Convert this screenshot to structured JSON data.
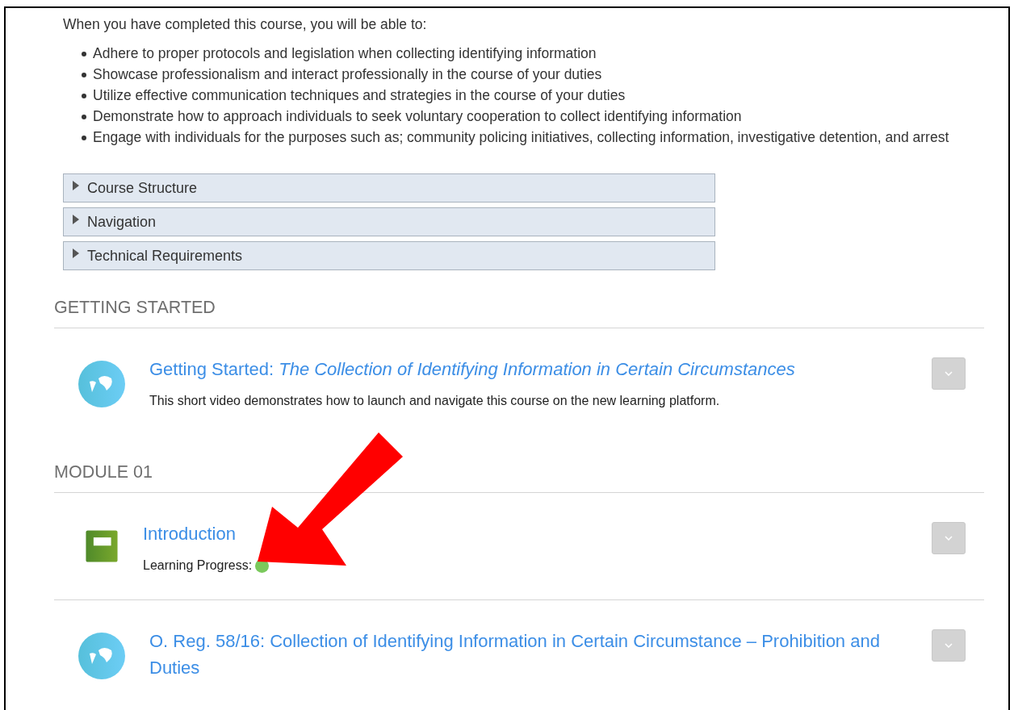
{
  "intro": "When you have completed this course, you will be able to:",
  "outcomes": [
    "Adhere to proper protocols and legislation when collecting identifying information",
    "Showcase professionalism and interact professionally in the course of your duties",
    "Utilize effective communication techniques and strategies in the course of your duties",
    "Demonstrate how to approach individuals to seek voluntary cooperation to collect identifying information",
    "Engage with individuals for the purposes such as; community policing initiatives, collecting information, investigative detention, and arrest"
  ],
  "collapsibles": [
    {
      "label": "Course Structure",
      "expanded": false
    },
    {
      "label": "Navigation",
      "expanded": false
    },
    {
      "label": "Technical Requirements",
      "expanded": false
    }
  ],
  "sections": [
    {
      "heading": "GETTING STARTED",
      "items": [
        {
          "kind": "video",
          "title": "Getting Started: *The Collection of Identifying Information in Certain Circumstances*",
          "description": "This short video demonstrates how to launch and navigate this course on the new learning platform."
        }
      ]
    },
    {
      "heading": "MODULE 01",
      "items": [
        {
          "kind": "book",
          "title": "Introduction",
          "progress_label": "Learning Progress:",
          "color": "#7ac95c"
        },
        {
          "kind": "video",
          "title": "O. Reg. 58/16: Collection of Identifying Information in Certain Circumstance – Prohibition and Duties"
        }
      ]
    }
  ]
}
